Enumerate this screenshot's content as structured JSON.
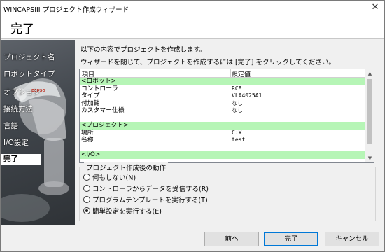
{
  "window": {
    "title": "WINCAPSIII プロジェクト作成ウィザード",
    "close_glyph": "✕"
  },
  "header": {
    "heading": "完了"
  },
  "sidebar": {
    "items": [
      {
        "label": "プロジェクト名"
      },
      {
        "label": "ロボットタイプ"
      },
      {
        "label": "オプション"
      },
      {
        "label": "接続方法"
      },
      {
        "label": "言語"
      },
      {
        "label": "I/O設定"
      },
      {
        "label": "完了"
      }
    ],
    "active_index": 6,
    "robot_logo": "DENSO"
  },
  "content": {
    "intro_line1": "以下の内容でプロジェクトを作成します。",
    "intro_line2": "ウィザードを閉じて、プロジェクトを作成するには [完了] をクリックしてください。",
    "table": {
      "columns": [
        "項目",
        "設定値"
      ],
      "rows": [
        {
          "type": "group",
          "c1": "<ロボット>",
          "c2": ""
        },
        {
          "type": "item",
          "c1": "コントローラ",
          "c2": "RC8"
        },
        {
          "type": "item",
          "c1": "タイプ",
          "c2": "VLA4025A1"
        },
        {
          "type": "item",
          "c1": "付加軸",
          "c2": "なし"
        },
        {
          "type": "item",
          "c1": "カスタマー仕様",
          "c2": "なし"
        },
        {
          "type": "blank",
          "c1": "",
          "c2": ""
        },
        {
          "type": "group",
          "c1": "<プロジェクト>",
          "c2": ""
        },
        {
          "type": "item",
          "c1": "場所",
          "c2": "C:¥"
        },
        {
          "type": "item",
          "c1": "名称",
          "c2": "test"
        },
        {
          "type": "blank",
          "c1": "",
          "c2": ""
        },
        {
          "type": "group",
          "c1": "<I/O>",
          "c2": ""
        }
      ]
    },
    "post_action": {
      "legend": "プロジェクト作成後の動作",
      "options": [
        {
          "label": "何もしない(N)",
          "checked": false
        },
        {
          "label": "コントローラからデータを受信する(R)",
          "checked": false
        },
        {
          "label": "プログラムテンプレートを実行する(T)",
          "checked": false
        },
        {
          "label": "簡単設定を実行する(E)",
          "checked": true
        }
      ]
    }
  },
  "footer": {
    "back_label": "前へ",
    "finish_label": "完了",
    "cancel_label": "キャンセル"
  },
  "colors": {
    "group_row": "#b6f5b6",
    "sidebar_bg": "#3f444a",
    "accent": "#0078d7"
  }
}
